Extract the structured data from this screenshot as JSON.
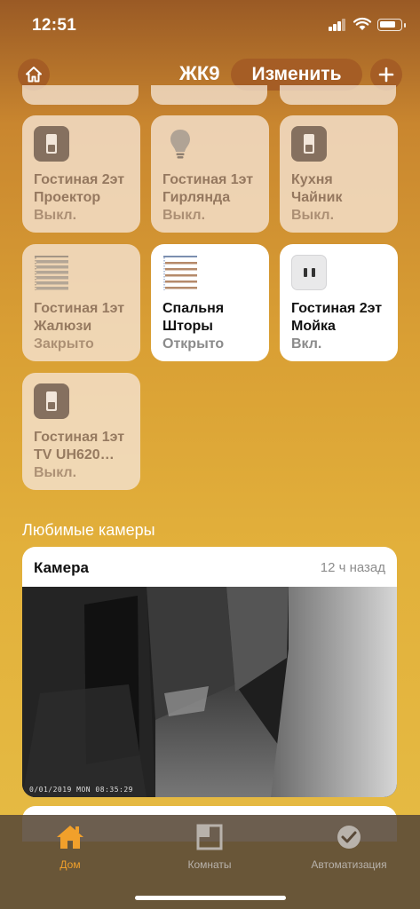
{
  "status_bar": {
    "time": "12:51"
  },
  "header": {
    "home_name": "ЖК9",
    "edit_label": "Изменить"
  },
  "tiles": [
    {
      "name": "Гостиная 2эт\nПроектор",
      "status": "Выкл.",
      "icon": "switch-icon",
      "state": "off"
    },
    {
      "name": "Гостиная 1эт\nГирлянда",
      "status": "Выкл.",
      "icon": "bulb-icon",
      "state": "off"
    },
    {
      "name": "Кухня\nЧайник",
      "status": "Выкл.",
      "icon": "switch-icon",
      "state": "off"
    },
    {
      "name": "Гостиная 1эт\nЖалюзи",
      "status": "Закрыто",
      "icon": "blinds-icon",
      "state": "off"
    },
    {
      "name": "Спальня\nШторы",
      "status": "Открыто",
      "icon": "blinds-icon",
      "state": "on"
    },
    {
      "name": "Гостиная 2эт\nМойка",
      "status": "Вкл.",
      "icon": "outlet-icon",
      "state": "on"
    },
    {
      "name": "Гостиная 1эт\nTV UH620…",
      "status": "Выкл.",
      "icon": "switch-icon",
      "state": "off"
    }
  ],
  "cameras_section": {
    "title": "Любимые камеры",
    "camera": {
      "name": "Камера",
      "time_ago": "12 ч назад",
      "timestamp": "0/01/2019 MON 08:35:29"
    }
  },
  "tab_bar": {
    "tabs": [
      {
        "label": "Дом",
        "icon": "house-icon",
        "active": true
      },
      {
        "label": "Комнаты",
        "icon": "rooms-icon",
        "active": false
      },
      {
        "label": "Автоматизация",
        "icon": "clock-icon",
        "active": false
      }
    ]
  },
  "colors": {
    "accent": "#a55d25",
    "tab_active": "#f1a02b"
  }
}
